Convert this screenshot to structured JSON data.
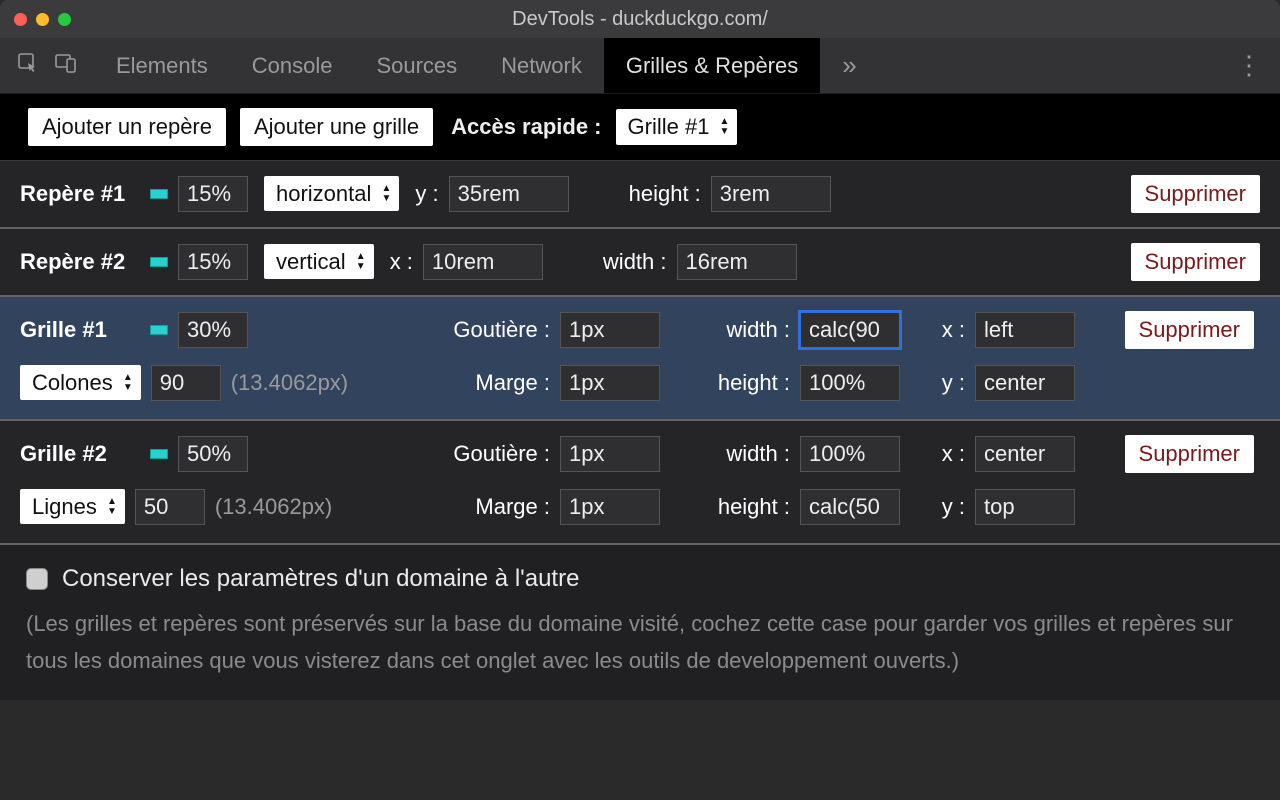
{
  "window": {
    "title": "DevTools - duckduckgo.com/"
  },
  "tabs": {
    "items": [
      "Elements",
      "Console",
      "Sources",
      "Network",
      "Grilles & Repères"
    ],
    "active": "Grilles & Repères",
    "more": "»",
    "kebab": "⋮"
  },
  "toolbar": {
    "add_marker": "Ajouter un repère",
    "add_grid": "Ajouter une grille",
    "quick_access_label": "Accès rapide :",
    "quick_access_value": "Grille #1"
  },
  "markers": [
    {
      "name": "Repère #1",
      "opacity": "15%",
      "orientation": "horizontal",
      "coord_label": "y :",
      "coord_value": "35rem",
      "size_label": "height :",
      "size_value": "3rem",
      "delete": "Supprimer"
    },
    {
      "name": "Repère #2",
      "opacity": "15%",
      "orientation": "vertical",
      "coord_label": "x :",
      "coord_value": "10rem",
      "size_label": "width :",
      "size_value": "16rem",
      "delete": "Supprimer"
    }
  ],
  "grids": [
    {
      "name": "Grille #1",
      "opacity": "30%",
      "gutter_label": "Goutière :",
      "gutter_value": "1px",
      "width_label": "width :",
      "width_value": "calc(90",
      "x_label": "x :",
      "x_value": "left",
      "mode": "Colones",
      "count": "90",
      "hint": "(13.4062px)",
      "margin_label": "Marge :",
      "margin_value": "1px",
      "height_label": "height :",
      "height_value": "100%",
      "y_label": "y :",
      "y_value": "center",
      "delete": "Supprimer",
      "selected": true,
      "focused_field": "width"
    },
    {
      "name": "Grille #2",
      "opacity": "50%",
      "gutter_label": "Goutière :",
      "gutter_value": "1px",
      "width_label": "width :",
      "width_value": "100%",
      "x_label": "x :",
      "x_value": "center",
      "mode": "Lignes",
      "count": "50",
      "hint": "(13.4062px)",
      "margin_label": "Marge :",
      "margin_value": "1px",
      "height_label": "height :",
      "height_value": "calc(50",
      "y_label": "y :",
      "y_value": "top",
      "delete": "Supprimer",
      "selected": false
    }
  ],
  "footer": {
    "checkbox_label": "Conserver les paramètres d'un domaine à l'autre",
    "description": "(Les grilles et repères sont préservés sur la base du domaine visité, cochez cette case pour garder vos grilles et repères sur tous les domaines que vous visterez dans cet onglet avec les outils de developpement ouverts.)"
  }
}
